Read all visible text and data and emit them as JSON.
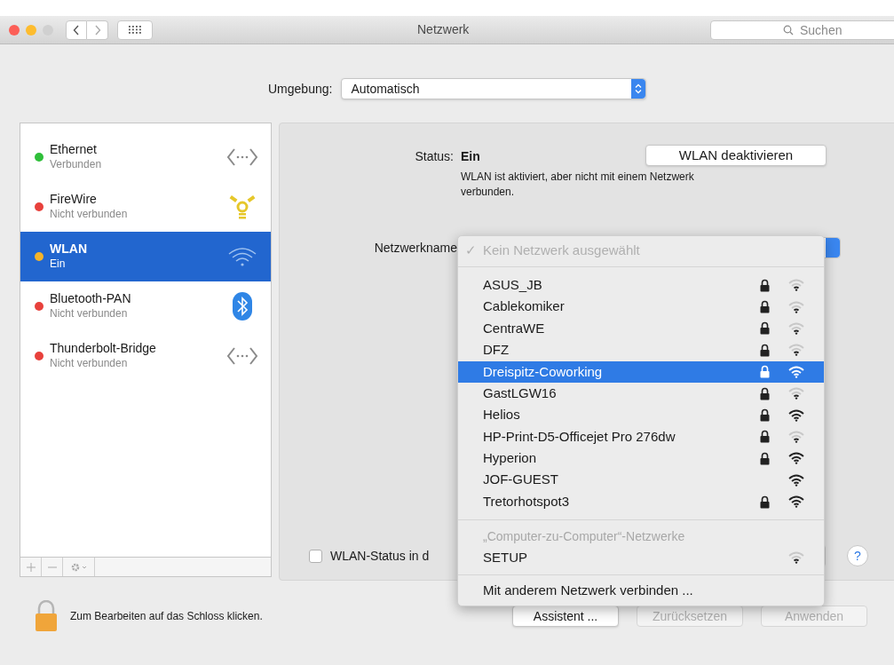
{
  "window": {
    "title": "Netzwerk",
    "search": {
      "placeholder": "Suchen"
    }
  },
  "location": {
    "label": "Umgebung:",
    "value": "Automatisch"
  },
  "services": [
    {
      "name": "Ethernet",
      "status": "Verbunden",
      "color": "#2fbf3a",
      "kind": "ethernet",
      "selected": false
    },
    {
      "name": "FireWire",
      "status": "Nicht verbunden",
      "color": "#e8413c",
      "kind": "firewire",
      "selected": false
    },
    {
      "name": "WLAN",
      "status": "Ein",
      "color": "#f5b42a",
      "kind": "wifi",
      "selected": true
    },
    {
      "name": "Bluetooth-PAN",
      "status": "Nicht verbunden",
      "color": "#e8413c",
      "kind": "bluetooth",
      "selected": false
    },
    {
      "name": "Thunderbolt-Bridge",
      "status": "Nicht verbunden",
      "color": "#e8413c",
      "kind": "ethernet",
      "selected": false
    }
  ],
  "detail": {
    "status_label": "Status:",
    "status_value": "Ein",
    "toggle_button": "WLAN deaktivieren",
    "status_note": "WLAN ist aktiviert, aber nicht mit einem Netzwerk verbunden.",
    "network_label": "Netzwerkname",
    "show_status_checkbox": {
      "label": "WLAN-Status in d",
      "checked": false
    }
  },
  "network_menu": {
    "header_check": "✓",
    "header": "Kein Netzwerk ausgewählt",
    "networks": [
      {
        "name": "ASUS_JB",
        "locked": true,
        "strong_signal": false,
        "selected": false
      },
      {
        "name": "Cablekomiker",
        "locked": true,
        "strong_signal": false,
        "selected": false
      },
      {
        "name": "CentraWE",
        "locked": true,
        "strong_signal": false,
        "selected": false
      },
      {
        "name": "DFZ",
        "locked": true,
        "strong_signal": false,
        "selected": false
      },
      {
        "name": "Dreispitz-Coworking",
        "locked": true,
        "strong_signal": true,
        "selected": true
      },
      {
        "name": "GastLGW16",
        "locked": true,
        "strong_signal": false,
        "selected": false
      },
      {
        "name": "Helios",
        "locked": true,
        "strong_signal": true,
        "selected": false
      },
      {
        "name": "HP-Print-D5-Officejet Pro 276dw",
        "locked": true,
        "strong_signal": false,
        "selected": false
      },
      {
        "name": "Hyperion",
        "locked": true,
        "strong_signal": true,
        "selected": false
      },
      {
        "name": "JOF-GUEST",
        "locked": false,
        "strong_signal": true,
        "selected": false
      },
      {
        "name": "Tretorhotspot3",
        "locked": true,
        "strong_signal": true,
        "selected": false
      }
    ],
    "adhoc_header": "„Computer-zu-Computer“-Netzwerke",
    "adhoc": [
      {
        "name": "SETUP",
        "locked": false,
        "strong_signal": false,
        "selected": false
      }
    ],
    "other": "Mit anderem Netzwerk verbinden ..."
  },
  "help_button": "?",
  "footer": {
    "lock_text": "Zum Bearbeiten auf das Schloss klicken.",
    "buttons": [
      {
        "label": "Assistent ...",
        "disabled": false
      },
      {
        "label": "Zurücksetzen",
        "disabled": true
      },
      {
        "label": "Anwenden",
        "disabled": true
      }
    ]
  }
}
